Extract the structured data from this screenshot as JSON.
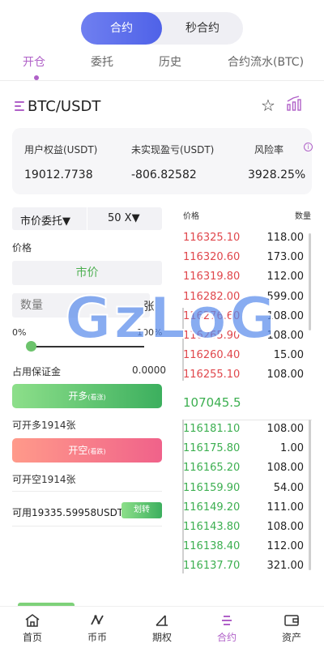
{
  "mode_toggle": {
    "active": "合约",
    "inactive": "秒合约"
  },
  "tabs": [
    "开仓",
    "委托",
    "历史",
    "合约流水(BTC)"
  ],
  "pair": "BTC/USDT",
  "summary": {
    "equity_label": "用户权益(USDT)",
    "equity_value": "19012.7738",
    "pnl_label": "未实现盈亏(USDT)",
    "pnl_value": "-806.82582",
    "risk_label": "风险率",
    "risk_value": "3928.25%"
  },
  "order_form": {
    "order_type": "市价委托▼",
    "leverage": "50 X▼",
    "price_label": "价格",
    "price_value": "市价",
    "qty_placeholder": "数量",
    "qty_unit": "张",
    "slider_min": "0%",
    "slider_max": "100%",
    "slider_percent": 0,
    "margin_label": "占用保证金",
    "margin_value": "0.0000",
    "long_label": "开多",
    "long_hint": "(看涨)",
    "can_long": "可开多1914张",
    "short_label": "开空",
    "short_hint": "(看跌)",
    "can_short": "可开空1914张",
    "available": "可用19335.59958USDT",
    "transfer_label": "划转"
  },
  "order_book": {
    "price_header": "价格",
    "qty_header": "数量",
    "asks": [
      {
        "price": "116325.10",
        "qty": "118.00"
      },
      {
        "price": "116320.60",
        "qty": "173.00"
      },
      {
        "price": "116319.80",
        "qty": "112.00"
      },
      {
        "price": "116282.00",
        "qty": "599.00"
      },
      {
        "price": "116276.60",
        "qty": "108.00"
      },
      {
        "price": "116265.90",
        "qty": "108.00"
      },
      {
        "price": "116260.40",
        "qty": "15.00"
      },
      {
        "price": "116255.10",
        "qty": "108.00"
      }
    ],
    "mid_price": "107045.5",
    "bids": [
      {
        "price": "116181.10",
        "qty": "108.00"
      },
      {
        "price": "116175.80",
        "qty": "1.00"
      },
      {
        "price": "116165.20",
        "qty": "108.00"
      },
      {
        "price": "116159.90",
        "qty": "54.00"
      },
      {
        "price": "116149.20",
        "qty": "111.00"
      },
      {
        "price": "116143.80",
        "qty": "108.00"
      },
      {
        "price": "116138.40",
        "qty": "112.00"
      },
      {
        "price": "116137.70",
        "qty": "321.00"
      }
    ]
  },
  "nav": [
    {
      "label": "首页",
      "icon": "home-icon"
    },
    {
      "label": "币币",
      "icon": "exchange-icon"
    },
    {
      "label": "期权",
      "icon": "options-icon"
    },
    {
      "label": "合约",
      "icon": "contract-icon"
    },
    {
      "label": "资产",
      "icon": "wallet-icon"
    }
  ],
  "nav_active": "合约",
  "colors": {
    "accent": "#b061c8",
    "buy": "#3caf50",
    "sell": "#e0474c",
    "toggle": "#5a6cec"
  },
  "watermark": "GzLoG"
}
